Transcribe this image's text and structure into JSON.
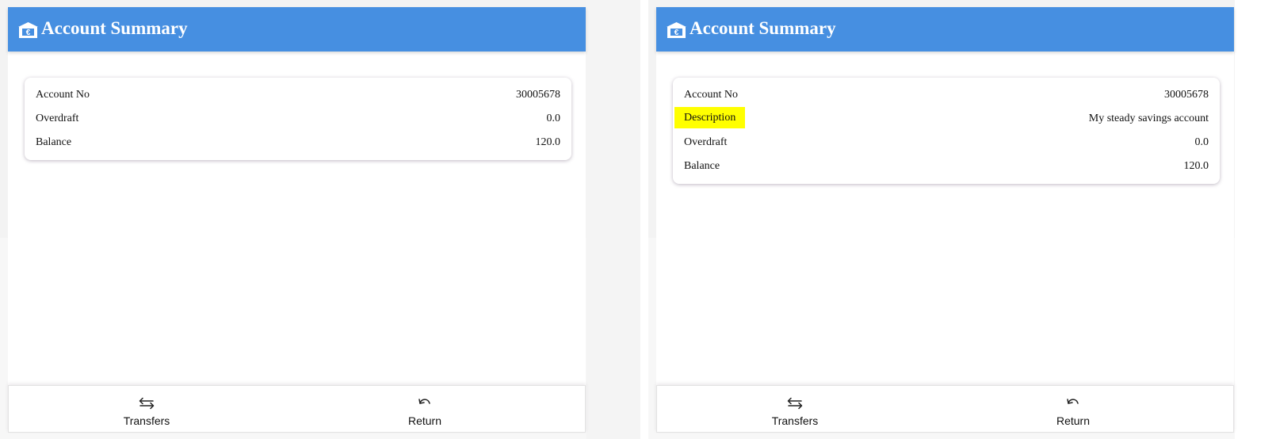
{
  "colors": {
    "header_bg": "#468fe1",
    "header_text": "#ffffff",
    "highlight": "#ffff00"
  },
  "panels": [
    {
      "header": {
        "icon": "bank-icon",
        "title": "Account Summary"
      },
      "rows": [
        {
          "label": "Account No",
          "value": "30005678"
        },
        {
          "label": "Overdraft",
          "value": "0.0"
        },
        {
          "label": "Balance",
          "value": "120.0"
        }
      ],
      "nav": [
        {
          "label": "Transfers",
          "icon": "transfer-arrows-icon"
        },
        {
          "label": "Return",
          "icon": "undo-arrow-icon"
        }
      ]
    },
    {
      "header": {
        "icon": "bank-icon",
        "title": "Account Summary"
      },
      "rows": [
        {
          "label": "Account No",
          "value": "30005678"
        },
        {
          "label": "Description",
          "value": "My steady savings account",
          "highlighted": true
        },
        {
          "label": "Overdraft",
          "value": "0.0"
        },
        {
          "label": "Balance",
          "value": "120.0"
        }
      ],
      "nav": [
        {
          "label": "Transfers",
          "icon": "transfer-arrows-icon"
        },
        {
          "label": "Return",
          "icon": "undo-arrow-icon"
        }
      ]
    }
  ]
}
